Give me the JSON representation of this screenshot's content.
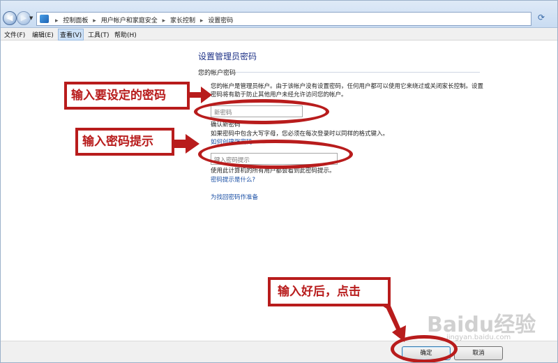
{
  "breadcrumb": [
    "控制面板",
    "用户帐户和家庭安全",
    "家长控制",
    "设置密码"
  ],
  "icons": {
    "back": "back-arrow-icon",
    "forward": "forward-arrow-icon",
    "folder": "control-panel-icon",
    "refresh": "refresh-icon"
  },
  "menu": [
    "文件(F)",
    "编辑(E)",
    "查看(V)",
    "工具(T)",
    "帮助(H)"
  ],
  "page": {
    "title": "设置管理员密码",
    "section_label": "您的帐户密码",
    "description": "您的帐户是管理员帐户。由于该帐户没有设置密码，任何用户都可以使用它来绕过或关闭家长控制。设置密码将有助于防止其他用户未经允许访问您的帐户。",
    "new_password_placeholder": "新密码",
    "confirm_label": "确认新密码",
    "case_hint": "如果密码中包含大写字母，您必须在每次登录时以同样的格式键入。",
    "strong_password_link": "如何创建强密码",
    "password_hint_placeholder": "键入密码提示",
    "hint_note": "使用此计算机的所有用户都会看到此密码提示。",
    "what_is_hint_link": "密码提示是什么?",
    "recover_link": "为找回密码作准备"
  },
  "buttons": {
    "ok": "确定",
    "cancel": "取消"
  },
  "annotations": {
    "enter_password": "输入要设定的密码",
    "enter_hint": "输入密码提示",
    "click_after": "输入好后，点击"
  },
  "watermark": {
    "brand": "Baidu经验",
    "url": "jingyan.baidu.com"
  },
  "colors": {
    "annotation_red": "#b81c1c",
    "title_blue": "#1e3287",
    "link_blue": "#1a4fa5"
  }
}
